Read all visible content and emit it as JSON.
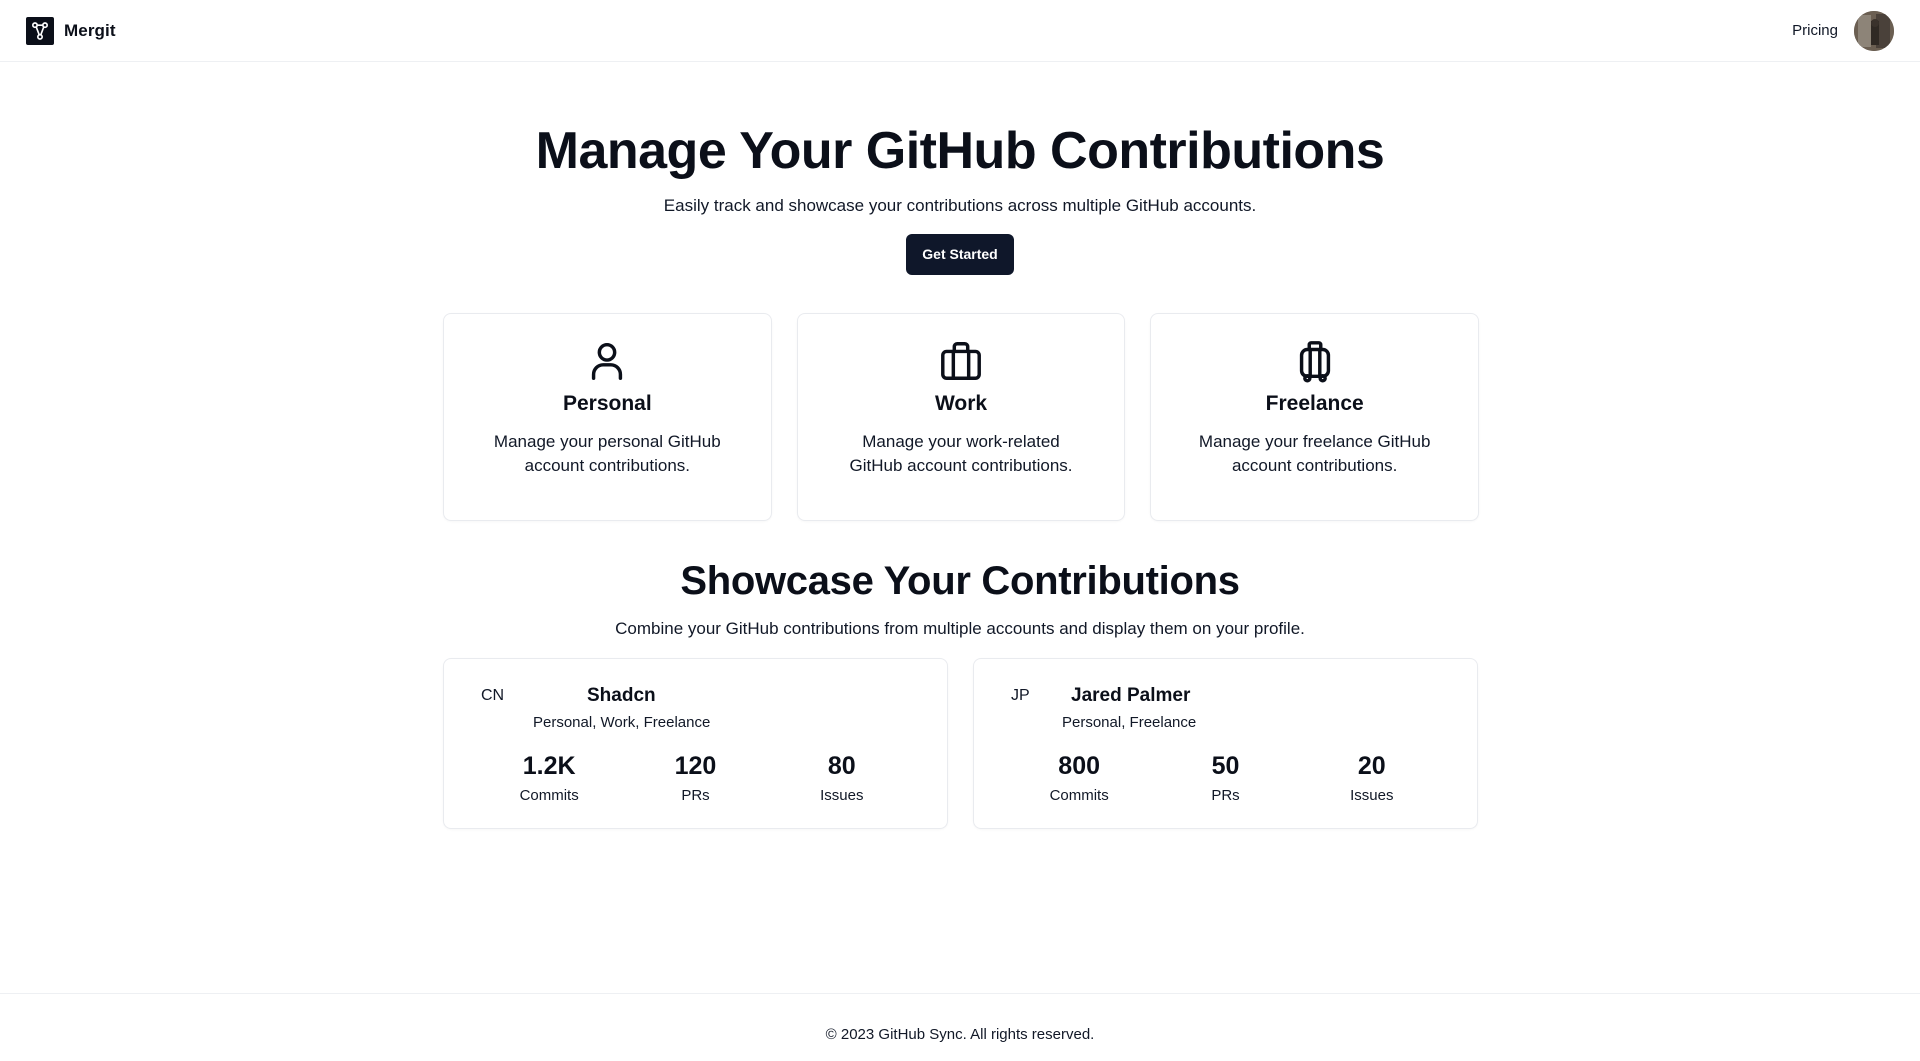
{
  "header": {
    "brand_name": "Mergit",
    "logo_icon": "git-merge-icon",
    "nav_pricing": "Pricing",
    "avatar_icon": "user-avatar"
  },
  "hero": {
    "title": "Manage Your GitHub Contributions",
    "subtitle": "Easily track and showcase your contributions across multiple GitHub accounts.",
    "cta_label": "Get Started"
  },
  "features": [
    {
      "icon": "user-icon",
      "title": "Personal",
      "description": "Manage your personal GitHub account contributions."
    },
    {
      "icon": "briefcase-icon",
      "title": "Work",
      "description": "Manage your work-related GitHub account contributions."
    },
    {
      "icon": "luggage-icon",
      "title": "Freelance",
      "description": "Manage your freelance GitHub account contributions."
    }
  ],
  "showcase": {
    "title": "Showcase Your Contributions",
    "subtitle": "Combine your GitHub contributions from multiple accounts and display them on your profile.",
    "profiles": [
      {
        "initials": "CN",
        "name": "Shadcn",
        "tags": "Personal, Work, Freelance",
        "stats": [
          {
            "value": "1.2K",
            "label": "Commits"
          },
          {
            "value": "120",
            "label": "PRs"
          },
          {
            "value": "80",
            "label": "Issues"
          }
        ]
      },
      {
        "initials": "JP",
        "name": "Jared Palmer",
        "tags": "Personal, Freelance",
        "stats": [
          {
            "value": "800",
            "label": "Commits"
          },
          {
            "value": "50",
            "label": "PRs"
          },
          {
            "value": "20",
            "label": "Issues"
          }
        ]
      }
    ]
  },
  "footer": {
    "text": "© 2023 GitHub Sync. All rights reserved."
  },
  "colors": {
    "primary": "#0f172a",
    "text": "#0b0f19",
    "border": "#e9ebef"
  }
}
